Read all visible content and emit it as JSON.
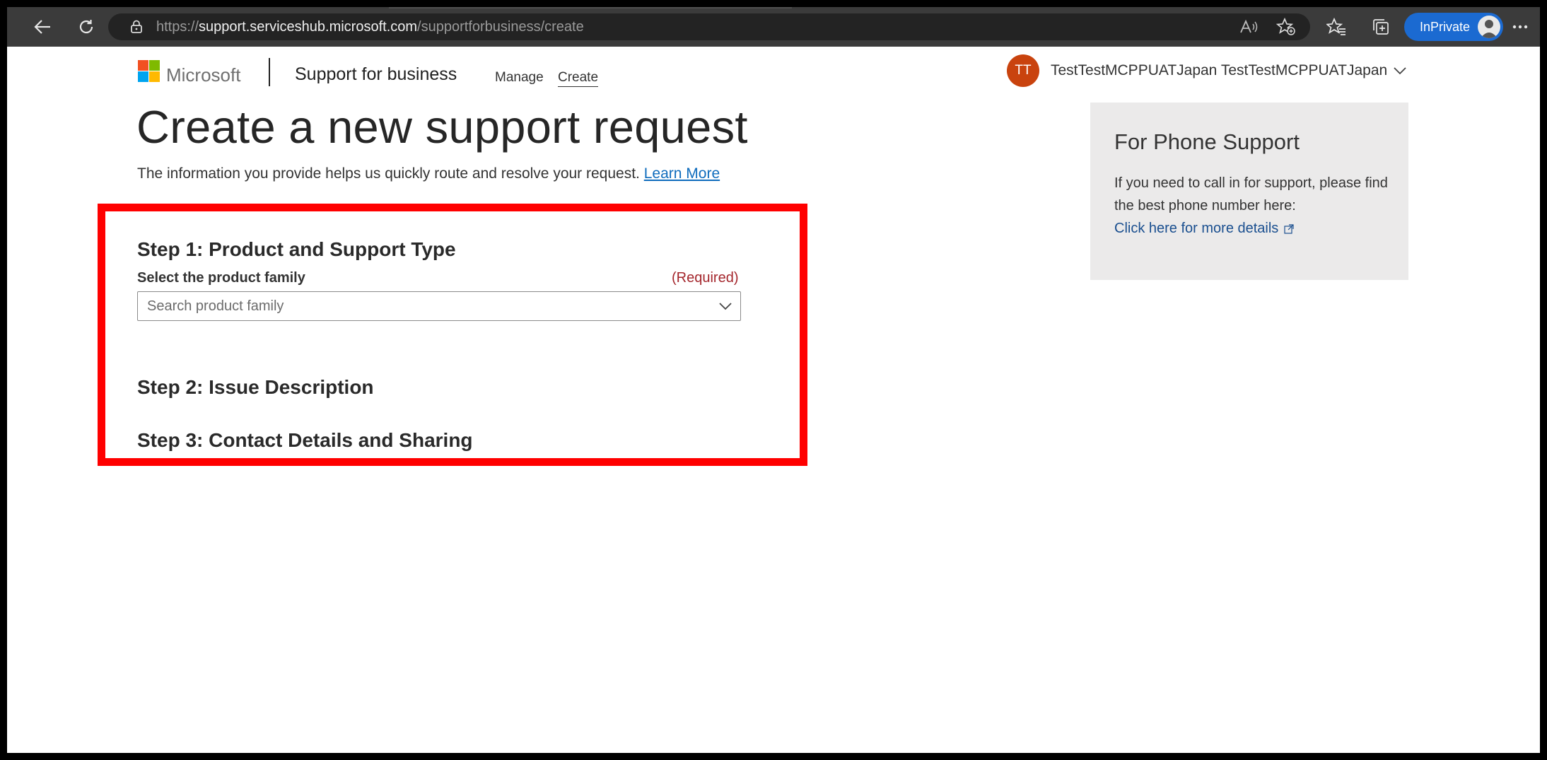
{
  "browser": {
    "url_prefix": "https://",
    "url_host": "support.serviceshub.microsoft.com",
    "url_path": "/supportforbusiness/create",
    "inprivate_label": "InPrivate",
    "accent": "#1b6ad1"
  },
  "header": {
    "brand": "Microsoft",
    "site_name": "Support for business",
    "nav": [
      {
        "label": "Manage"
      },
      {
        "label": "Create"
      }
    ],
    "user": {
      "initials": "TT",
      "name": "TestTestMCPPUATJapan TestTestMCPPUATJapan",
      "avatar_color": "#c9430e"
    }
  },
  "main": {
    "title": "Create a new support request",
    "intro": "The information you provide helps us quickly route and resolve your request.",
    "learn_more": "Learn More",
    "step1": {
      "title": "Step 1: Product and Support Type",
      "field_label": "Select the product family",
      "required": "(Required)",
      "placeholder": "Search product family"
    },
    "step2": {
      "title": "Step 2: Issue Description"
    },
    "step3": {
      "title": "Step 3: Contact Details and Sharing"
    },
    "highlight_color": "#ff0000"
  },
  "phone_card": {
    "title": "For Phone Support",
    "text": "If you need to call in for support, please find the best phone number here:",
    "link": "Click here for more details"
  }
}
